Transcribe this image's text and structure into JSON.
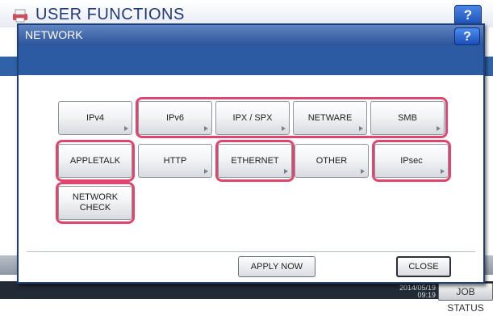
{
  "background": {
    "title": "USER FUNCTIONS",
    "help_label": "?",
    "date_line": "2014/05/19",
    "time_line": "09:19",
    "job_status_label": "JOB STATUS"
  },
  "dialog": {
    "title": "NETWORK",
    "help_label": "?",
    "options": [
      {
        "label": "IPv4"
      },
      {
        "label": "IPv6"
      },
      {
        "label": "IPX / SPX"
      },
      {
        "label": "NETWARE"
      },
      {
        "label": "SMB"
      },
      {
        "label": "APPLETALK"
      },
      {
        "label": "HTTP"
      },
      {
        "label": "ETHERNET"
      },
      {
        "label": "OTHER"
      },
      {
        "label": "IPsec"
      },
      {
        "label_line1": "NETWORK",
        "label_line2": "CHECK"
      }
    ],
    "apply_now_label": "APPLY NOW",
    "close_label": "CLOSE"
  },
  "colors": {
    "highlight": "#e0456e",
    "title_bar": "#2c5499",
    "band": "#2c5aa3"
  },
  "icons": {
    "background_app_icon": "printer-icon",
    "submenu_indicator": "triangle-right-icon"
  }
}
